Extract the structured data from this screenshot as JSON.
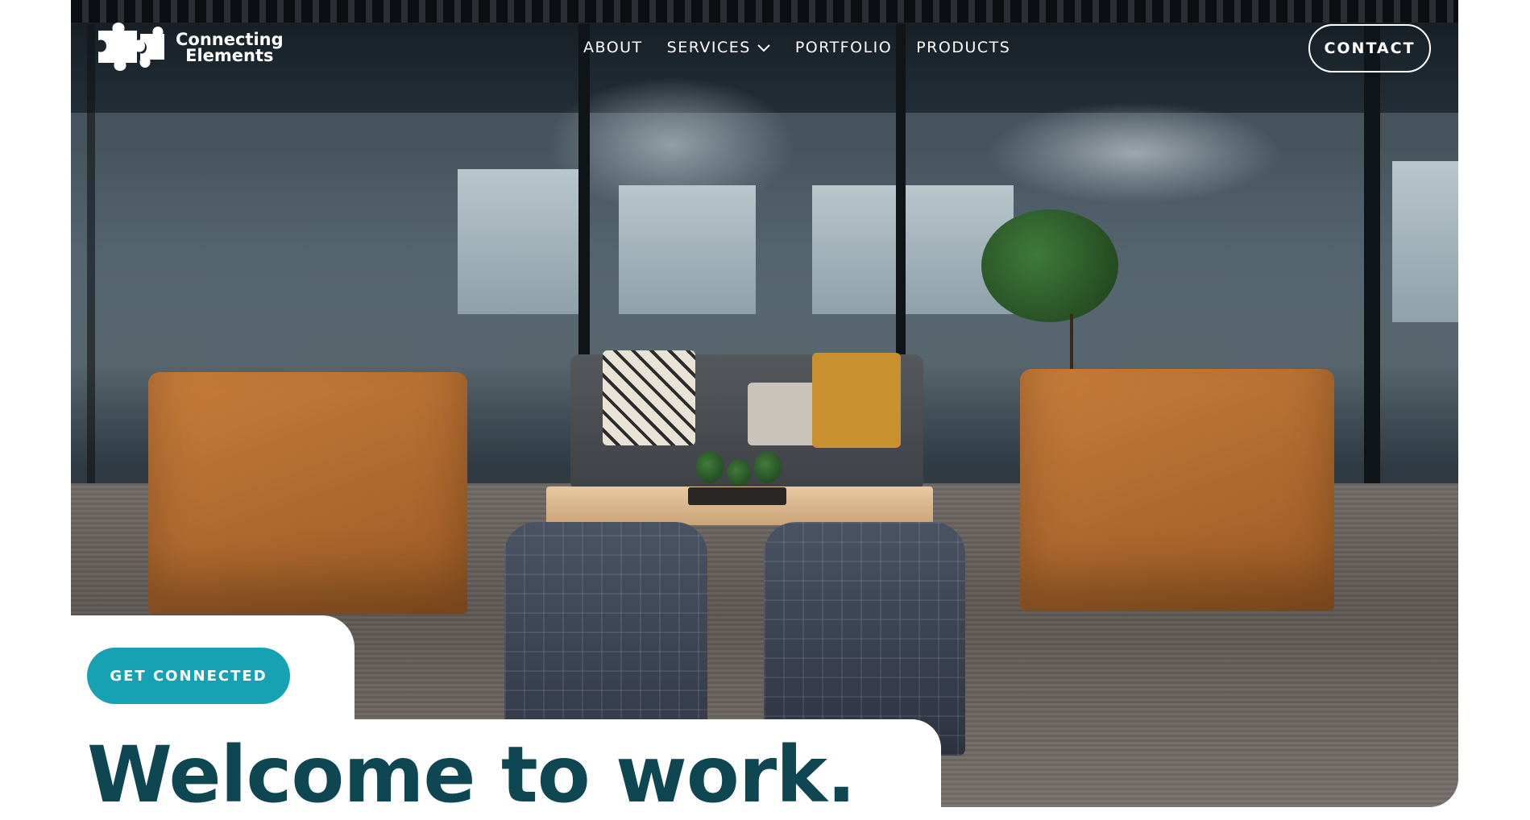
{
  "brand": {
    "name_line1": "Connecting",
    "name_line2": "Elements"
  },
  "nav": {
    "items": [
      {
        "label": "ABOUT"
      },
      {
        "label": "SERVICES",
        "has_dropdown": true
      },
      {
        "label": "PORTFOLIO"
      },
      {
        "label": "PRODUCTS"
      }
    ]
  },
  "header": {
    "contact_label": "CONTACT"
  },
  "hero": {
    "image_alt": "office lounge with armchairs, sofa and glass conference room",
    "cta_label": "GET CONNECTED",
    "headline": "Welcome to work."
  },
  "colors": {
    "accent": "#17a2b3",
    "headline": "#0e4752",
    "background": "#ffffff"
  }
}
